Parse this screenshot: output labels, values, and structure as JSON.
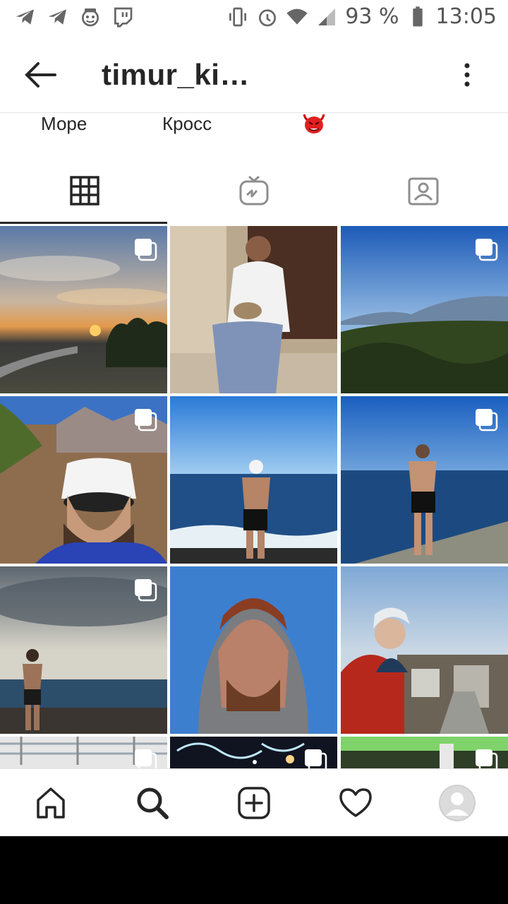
{
  "status_bar": {
    "battery_percent": "93 %",
    "time": "13:05",
    "left_icons": [
      "telegram-icon",
      "telegram-icon",
      "monkey-app-icon",
      "twitch-icon"
    ],
    "right_icons": [
      "vibrate-icon",
      "alarm-icon",
      "wifi-icon",
      "signal-icon",
      "battery-icon"
    ]
  },
  "header": {
    "title": "timur_ki…"
  },
  "highlights": {
    "items": [
      {
        "label": "Море"
      },
      {
        "label": "Кросс"
      },
      {
        "label": "",
        "icon": "devil-emoji-icon"
      }
    ]
  },
  "tabs": {
    "items": [
      {
        "name": "grid",
        "icon": "grid-icon",
        "active": true
      },
      {
        "name": "igtv",
        "icon": "igtv-icon",
        "active": false
      },
      {
        "name": "tagged",
        "icon": "tagged-icon",
        "active": false
      }
    ]
  },
  "grid": {
    "tiles": [
      {
        "subject": "sunset",
        "multi": true
      },
      {
        "subject": "man-with-kittens",
        "multi": false
      },
      {
        "subject": "mountain-landscape",
        "multi": true
      },
      {
        "subject": "selfie-bucket-hat",
        "multi": true
      },
      {
        "subject": "sea-back-view",
        "multi": false
      },
      {
        "subject": "sea-shirtless",
        "multi": true
      },
      {
        "subject": "beach-cloudy",
        "multi": true
      },
      {
        "subject": "hoodie-portrait",
        "multi": false
      },
      {
        "subject": "city-view-cap",
        "multi": false
      },
      {
        "subject": "indoor-ceiling",
        "multi": true
      },
      {
        "subject": "night-lights",
        "multi": true
      },
      {
        "subject": "green-indoor",
        "multi": true
      }
    ]
  },
  "bottom_nav": {
    "items": [
      "home-icon",
      "search-icon",
      "add-post-icon",
      "heart-icon",
      "profile-avatar"
    ]
  },
  "colors": {
    "text": "#262626",
    "divider": "#e6e6e6",
    "icon_gray": "#666666"
  }
}
